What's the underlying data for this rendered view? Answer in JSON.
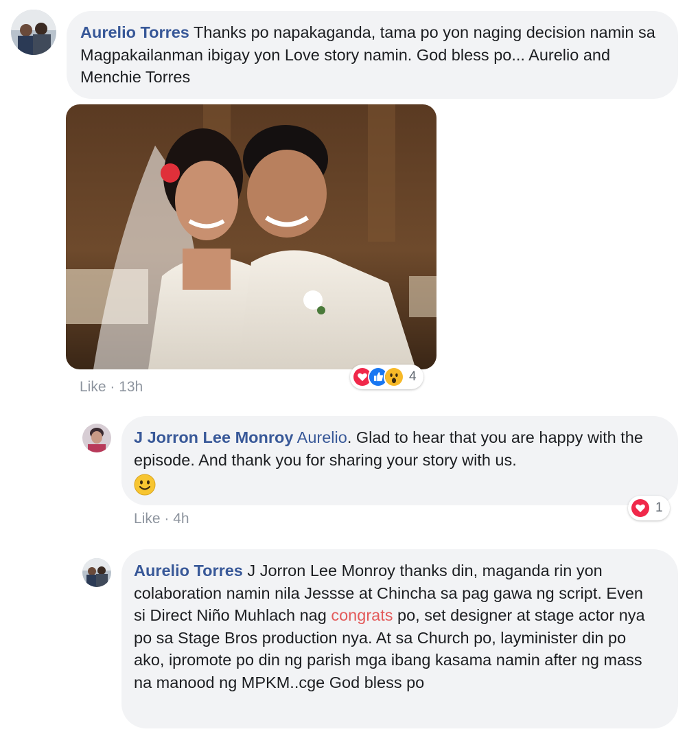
{
  "comments": [
    {
      "author": "Aurelio Torres",
      "text": " Thanks po napakaganda, tama po yon naging decision namin sa Magpakailanman ibigay yon Love story namin. God bless po... Aurelio and Menchie Torres",
      "like_label": "Like",
      "time": "13h",
      "reaction_count": "4",
      "reactions": [
        "love-icon",
        "like-icon",
        "wow-icon"
      ]
    },
    {
      "author": "J Jorron Lee Monroy",
      "mention": "Aurelio",
      "text": ". Glad to hear that you are happy with the episode. And thank you for sharing your story with us.",
      "emoji": "🙂",
      "like_label": "Like",
      "time": "4h",
      "reaction_count": "1",
      "reactions": [
        "love-icon"
      ]
    },
    {
      "author": "Aurelio Torres",
      "text_before": " J Jorron Lee Monroy thanks din, maganda rin yon colaboration namin nila Jessse at Chincha sa pag gawa ng script. Even si Direct Niño Muhlach nag ",
      "highlight": "congrats",
      "text_after": " po, set designer at stage actor nya po sa Stage Bros production nya. At sa Church po, layminister din po ako, ipromote po din ng parish mga ibang kasama namin after ng mass na manood ng MPKM..cge God bless po"
    }
  ],
  "meta_separator": " · ",
  "colors": {
    "author": "#385898",
    "bubble": "#f2f3f5",
    "meta": "#8d949e",
    "love": "#f0284a",
    "like": "#1877f2",
    "wow": "#f7b928"
  }
}
